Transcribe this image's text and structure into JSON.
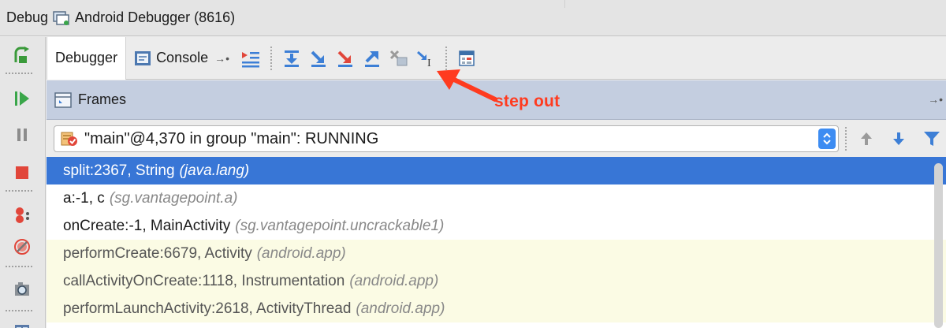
{
  "window": {
    "prefix": "Debug",
    "title": "Android Debugger (8616)"
  },
  "tabs": [
    {
      "label": "Debugger",
      "active": true
    },
    {
      "label": "Console",
      "active": false
    }
  ],
  "toolbar": {
    "icons": [
      "show-execution-point-icon",
      "step-over-icon",
      "step-into-icon",
      "force-step-into-icon",
      "step-out-icon",
      "drop-frame-icon",
      "run-to-cursor-icon",
      "evaluate-expression-icon"
    ]
  },
  "frames_panel": {
    "title": "Frames"
  },
  "annotation": {
    "text": "step out",
    "color": "#ff3b1f"
  },
  "thread": {
    "selected": "\"main\"@4,370 in group \"main\": RUNNING"
  },
  "frames": [
    {
      "method": "split:2367, String",
      "package": "(java.lang)",
      "state": "selected"
    },
    {
      "method": "a:-1, c",
      "package": "(sg.vantagepoint.a)",
      "state": "normal"
    },
    {
      "method": "onCreate:-1, MainActivity",
      "package": "(sg.vantagepoint.uncrackable1)",
      "state": "normal"
    },
    {
      "method": "performCreate:6679, Activity",
      "package": "(android.app)",
      "state": "library"
    },
    {
      "method": "callActivityOnCreate:1118, Instrumentation",
      "package": "(android.app)",
      "state": "library"
    },
    {
      "method": "performLaunchActivity:2618, ActivityThread",
      "package": "(android.app)",
      "state": "library"
    }
  ],
  "colors": {
    "selection": "#3876d6",
    "library_row": "#fbfbe4",
    "frames_header": "#c4cee0",
    "accent": "#3d8cf2"
  }
}
